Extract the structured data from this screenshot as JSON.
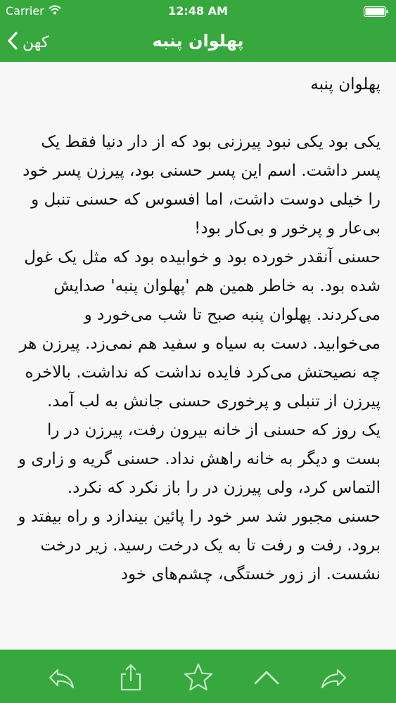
{
  "status_bar": {
    "carrier": "Carrier",
    "time": "12:48 AM",
    "wifi_icon": "wifi-icon",
    "battery_icon": "battery-icon"
  },
  "nav": {
    "back_label": "کهن",
    "back_icon": "chevron-left-icon",
    "title": "پهلوان پنبه"
  },
  "story": {
    "title": "پهلوان پنبه",
    "paragraphs": [
      "یکی بود یکی نبود پیرزنی بود که از دار دنیا فقط یک پسر داشت. اسم این پسر حسنی بود، پیرزن پسر خود را خیلی دوست داشت، اما افسوس که حسنی تنبل و بی‌عار و پرخور و بی‌کار بود!",
      "حسنی آنقدر خورده بود و خوابیده بود که مثل یک غول شده بود. به خاطر همین هم 'پهلوان پنبه' صدایش می‌کردند. پهلوان پنبه صبح تا شب می‌خورد و می‌خوابید. دست به سیاه و سفید هم نمی‌زد. پیرزن هر چه نصیحتش می‌کرد فایده نداشت که نداشت. بالاخره پیرزن از تنبلی و پرخوری حسنی جانش به لب آمد.",
      "یک روز که حسنی از خانه بیرون رفت، پیرزن در را بست و دیگر به خانه راهش نداد. حسنی گریه و زاری و التماس کرد، ولی پیرزن در را باز نکرد که نکرد.",
      "حسنی مجبور شد سر خود را پائین بیندازد و راه بیفتد و برود. رفت و رفت تا به یک درخت رسید. زیر درخت نشست. از زور خستگی، چشم‌های خود"
    ]
  },
  "toolbar": {
    "items": [
      "reply-back-icon",
      "share-icon",
      "star-icon",
      "chevron-up-icon",
      "forward-icon"
    ]
  },
  "colors": {
    "accent": "#36a83e",
    "background": "#f7f7f7",
    "text": "#111111"
  }
}
